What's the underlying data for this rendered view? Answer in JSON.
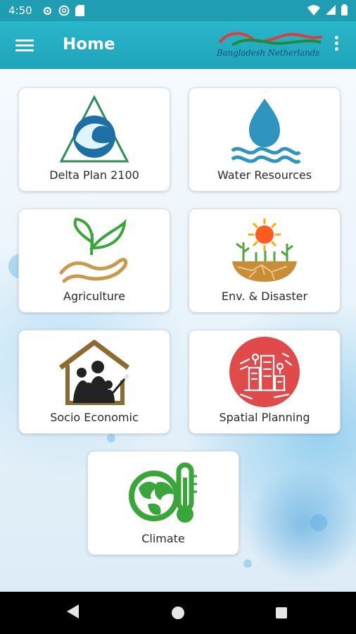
{
  "status_bar": {
    "time": "4:50",
    "icons": [
      "gear-icon",
      "at-icon",
      "sd-card-icon",
      "wifi-icon",
      "signal-icon",
      "battery-icon"
    ]
  },
  "app_bar": {
    "title": "Home",
    "brand": "Bangladesh Netherlands",
    "accent": "#1fa4ba"
  },
  "tiles": [
    {
      "label": "Delta Plan 2100",
      "icon": "delta-plan-icon"
    },
    {
      "label": "Water Resources",
      "icon": "water-drop-icon"
    },
    {
      "label": "Agriculture",
      "icon": "agriculture-icon"
    },
    {
      "label": "Env. & Disaster",
      "icon": "environment-icon"
    },
    {
      "label": "Socio Economic",
      "icon": "family-home-icon"
    },
    {
      "label": "Spatial Planning",
      "icon": "spatial-planning-icon"
    },
    {
      "label": "Climate",
      "icon": "climate-icon"
    }
  ],
  "colors": {
    "water": "#2f95bf",
    "leaf": "#3aa63a",
    "earth": "#c99a4b",
    "red": "#e14a4a",
    "house": "#8b6b2f"
  }
}
